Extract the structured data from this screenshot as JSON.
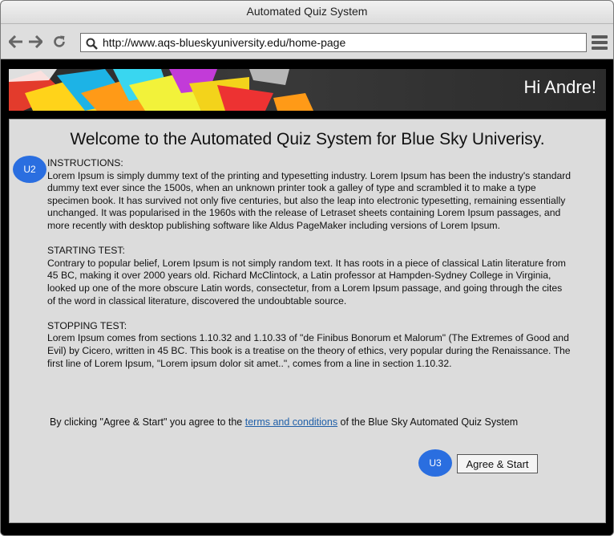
{
  "window": {
    "title": "Automated Quiz System"
  },
  "toolbar": {
    "url": "http://www.aqs-blueskyuniversity.edu/home-page",
    "icons": [
      "back-arrow-icon",
      "forward-arrow-icon",
      "reload-icon",
      "search-icon",
      "hamburger-menu-icon"
    ]
  },
  "banner": {
    "greeting": "Hi Andre!"
  },
  "main": {
    "heading": "Welcome to the Automated Quiz System for Blue Sky Univerisy.",
    "sections": [
      {
        "label": "INSTRUCTIONS:",
        "body": "Lorem Ipsum is simply dummy text of the printing and typesetting industry. Lorem Ipsum has been the industry's standard dummy text ever since the 1500s, when an unknown printer took a galley of type and scrambled it to make a type specimen book. It has survived not only five centuries, but also the leap into electronic typesetting, remaining essentially unchanged. It was popularised in the 1960s with the release of Letraset sheets containing Lorem Ipsum passages, and more recently with desktop publishing software like Aldus PageMaker including versions of Lorem Ipsum."
      },
      {
        "label": "STARTING TEST:",
        "body": "Contrary to popular belief, Lorem Ipsum is not simply random text. It has roots in a piece of classical Latin literature from 45 BC, making it over 2000 years old. Richard McClintock, a Latin professor at Hampden-Sydney College in Virginia, looked up one of the more obscure Latin words, consectetur, from a Lorem Ipsum passage, and going through the cites of the word in classical literature, discovered the undoubtable source."
      },
      {
        "label": "STOPPING TEST:",
        "body": "Lorem Ipsum comes from sections 1.10.32 and 1.10.33 of \"de Finibus Bonorum et Malorum\" (The Extremes of Good and Evil) by Cicero, written in 45 BC. This book is a treatise on the theory of ethics, very popular during the Renaissance. The first line of Lorem Ipsum, \"Lorem ipsum dolor sit amet..\", comes from a line in section 1.10.32."
      }
    ],
    "agreement": {
      "prefix": "By clicking \"Agree & Start\" you agree to the ",
      "link": "terms and conditions",
      "suffix": " of the Blue Sky Automated Quiz System"
    },
    "agree_button": "Agree & Start"
  },
  "annotations": {
    "u2": "U2",
    "u3": "U3"
  },
  "colors": {
    "badge": "#2a6ee0",
    "link": "#1f5fa8",
    "content_bg": "#dcdcdc"
  }
}
